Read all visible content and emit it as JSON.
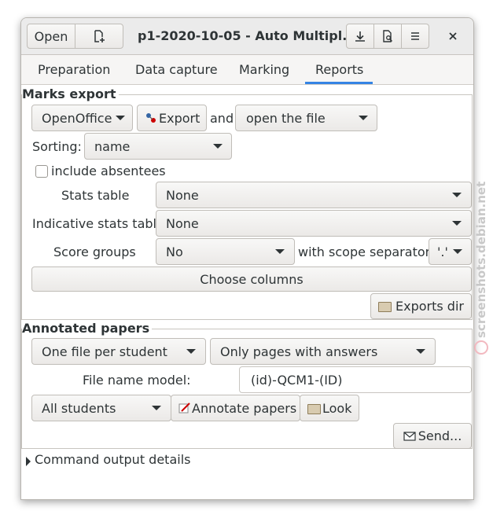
{
  "window": {
    "title": "p1-2020-10-05 - Auto Multipl...",
    "open_label": "Open",
    "buttons": [
      "new-document-icon",
      "download-icon",
      "document-search-icon",
      "menu-icon",
      "close-icon"
    ]
  },
  "tabs": [
    {
      "label": "Preparation"
    },
    {
      "label": "Data capture"
    },
    {
      "label": "Marking"
    },
    {
      "label": "Reports",
      "active": true
    }
  ],
  "marks_export": {
    "heading": "Marks export",
    "format": "OpenOffice",
    "export_label": "Export",
    "and_label": "and",
    "after_export": "open the file",
    "sorting_label": "Sorting:",
    "sorting_value": "name",
    "include_absentees_label": "include absentees",
    "include_absentees": false,
    "stats_table_label": "Stats table",
    "stats_table_value": "None",
    "indicative_stats_label": "Indicative stats table",
    "indicative_stats_value": "None",
    "score_groups_label": "Score groups",
    "score_groups_value": "No",
    "scope_separator_label": "with scope separator",
    "scope_separator_value": "'.'",
    "choose_columns_label": "Choose columns",
    "exports_dir_label": "Exports dir"
  },
  "annotated_papers": {
    "heading": "Annotated papers",
    "file_mode": "One file per student",
    "pages_mode": "Only pages with answers",
    "file_name_model_label": "File name model:",
    "file_name_model_value": "(id)-QCM1-(ID)",
    "students_value": "All students",
    "annotate_label": "Annotate papers",
    "look_label": "Look",
    "send_label": "Send..."
  },
  "command_output_label": "Command output details",
  "watermark": "screenshots.debian.net",
  "colors": {
    "accent": "#3584e4",
    "window_bg": "#f6f5f4",
    "header_bg": "#ebebeb"
  }
}
